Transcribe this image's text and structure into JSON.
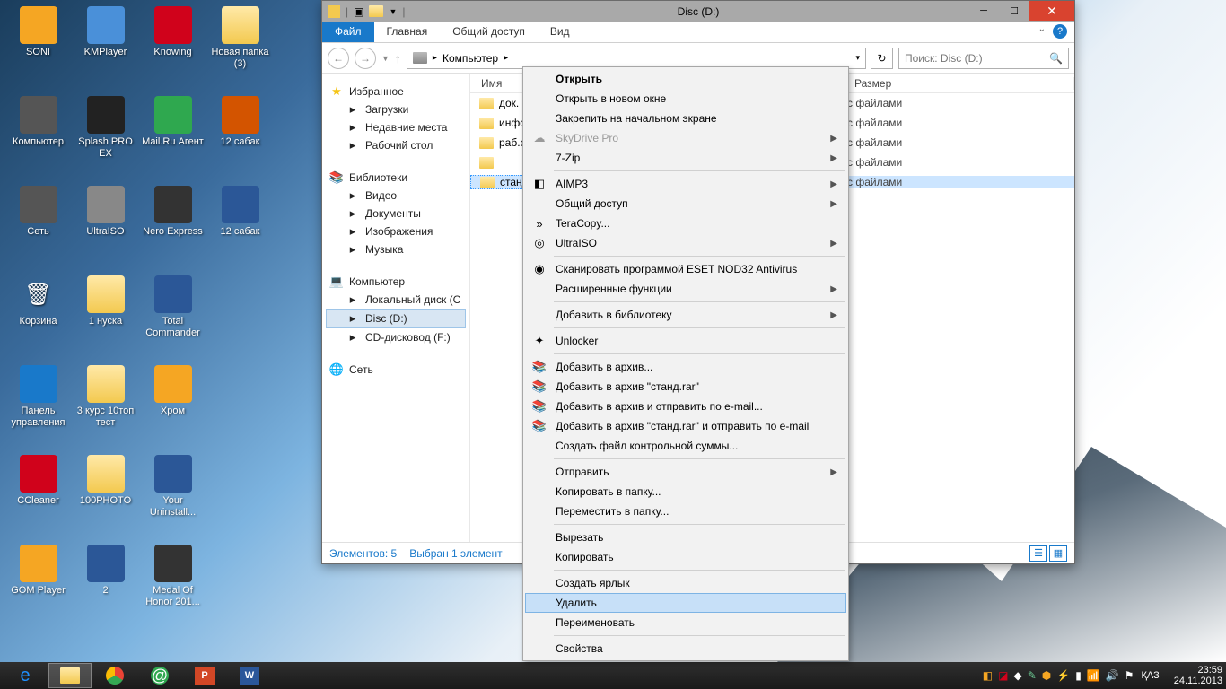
{
  "desktop_icons": [
    {
      "label": "SONI",
      "type": "app",
      "color": "#f5a623"
    },
    {
      "label": "KMPlayer",
      "type": "app",
      "color": "#4a90d9"
    },
    {
      "label": "Knowing",
      "type": "app",
      "color": "#d0021b"
    },
    {
      "label": "Новая папка (3)",
      "type": "folder"
    },
    {
      "label": "Компьютер",
      "type": "app",
      "color": "#555"
    },
    {
      "label": "Splash PRO EX",
      "type": "app",
      "color": "#222"
    },
    {
      "label": "Mail.Ru Агент",
      "type": "app",
      "color": "#2fa84f"
    },
    {
      "label": "12 сабак",
      "type": "app",
      "color": "#d35400"
    },
    {
      "label": "Сеть",
      "type": "app",
      "color": "#555"
    },
    {
      "label": "UltraISO",
      "type": "app",
      "color": "#888"
    },
    {
      "label": "Nero Express",
      "type": "app",
      "color": "#333"
    },
    {
      "label": "12 сабак",
      "type": "app",
      "color": "#2b5797"
    },
    {
      "label": "Корзина",
      "type": "recycle"
    },
    {
      "label": "1 нуска",
      "type": "folder"
    },
    {
      "label": "Total Commander",
      "type": "app",
      "color": "#2b5797"
    },
    {
      "label": ""
    },
    {
      "label": "Панель управления",
      "type": "app",
      "color": "#1979ca"
    },
    {
      "label": "3 курс 10топ тест",
      "type": "folder"
    },
    {
      "label": "Хром",
      "type": "app",
      "color": "#f5a623"
    },
    {
      "label": ""
    },
    {
      "label": "CCleaner",
      "type": "app",
      "color": "#d0021b"
    },
    {
      "label": "100PHOTO",
      "type": "folder"
    },
    {
      "label": "Your Uninstall...",
      "type": "app",
      "color": "#2b5797"
    },
    {
      "label": ""
    },
    {
      "label": "GOM Player",
      "type": "app",
      "color": "#f5a623"
    },
    {
      "label": "2",
      "type": "app",
      "color": "#2b5797"
    },
    {
      "label": "Medal Of Honor 201...",
      "type": "app",
      "color": "#333"
    }
  ],
  "window": {
    "title": "Disc (D:)",
    "ribbon": {
      "file": "Файл",
      "tabs": [
        "Главная",
        "Общий доступ",
        "Вид"
      ]
    },
    "breadcrumb": [
      "Компьютер"
    ],
    "search_placeholder": "Поиск: Disc (D:)",
    "navpane": {
      "favorites": {
        "header": "Избранное",
        "items": [
          "Загрузки",
          "Недавние места",
          "Рабочий стол"
        ]
      },
      "libraries": {
        "header": "Библиотеки",
        "items": [
          "Видео",
          "Документы",
          "Изображения",
          "Музыка"
        ]
      },
      "computer": {
        "header": "Компьютер",
        "items": [
          "Локальный диск (C",
          "Disc (D:)",
          "CD-дисковод (F:)"
        ],
        "selected": 1
      },
      "network": {
        "header": "Сеть"
      }
    },
    "columns": {
      "name": "Имя",
      "size": "Размер"
    },
    "files": [
      {
        "name": "док.",
        "type": "с файлами"
      },
      {
        "name": "инфо",
        "type": "с файлами"
      },
      {
        "name": "раб.с",
        "type": "с файлами"
      },
      {
        "name": "",
        "type": "с файлами"
      },
      {
        "name": "станд",
        "type": "с файлами",
        "selected": true
      }
    ],
    "status": {
      "count": "Элементов: 5",
      "selected": "Выбран 1 элемент"
    }
  },
  "context_menu": [
    {
      "label": "Открыть",
      "bold": true
    },
    {
      "label": "Открыть в новом окне"
    },
    {
      "label": "Закрепить на начальном экране"
    },
    {
      "label": "SkyDrive Pro",
      "icon": "☁",
      "disabled": true,
      "arrow": true
    },
    {
      "label": "7-Zip",
      "arrow": true
    },
    {
      "sep": true
    },
    {
      "label": "AIMP3",
      "icon": "◧",
      "arrow": true
    },
    {
      "label": "Общий доступ",
      "arrow": true
    },
    {
      "label": "TeraCopy...",
      "icon": "»"
    },
    {
      "label": "UltraISO",
      "icon": "◎",
      "arrow": true
    },
    {
      "sep": true
    },
    {
      "label": "Сканировать программой ESET NOD32 Antivirus",
      "icon": "◉"
    },
    {
      "label": "Расширенные функции",
      "arrow": true
    },
    {
      "sep": true
    },
    {
      "label": "Добавить в библиотеку",
      "arrow": true
    },
    {
      "sep": true
    },
    {
      "label": "Unlocker",
      "icon": "✦"
    },
    {
      "sep": true
    },
    {
      "label": "Добавить в архив...",
      "icon": "📚"
    },
    {
      "label": "Добавить в архив \"станд.rar\"",
      "icon": "📚"
    },
    {
      "label": "Добавить в архив и отправить по e-mail...",
      "icon": "📚"
    },
    {
      "label": "Добавить в архив \"станд.rar\" и отправить по e-mail",
      "icon": "📚"
    },
    {
      "label": "Создать файл контрольной суммы..."
    },
    {
      "sep": true
    },
    {
      "label": "Отправить",
      "arrow": true
    },
    {
      "label": "Копировать в папку..."
    },
    {
      "label": "Переместить в папку..."
    },
    {
      "sep": true
    },
    {
      "label": "Вырезать"
    },
    {
      "label": "Копировать"
    },
    {
      "sep": true
    },
    {
      "label": "Создать ярлык"
    },
    {
      "label": "Удалить",
      "hover": true
    },
    {
      "label": "Переименовать"
    },
    {
      "sep": true
    },
    {
      "label": "Свойства"
    }
  ],
  "taskbar": {
    "lang": "ҚАЗ",
    "time": "23:59",
    "date": "24.11.2013"
  }
}
